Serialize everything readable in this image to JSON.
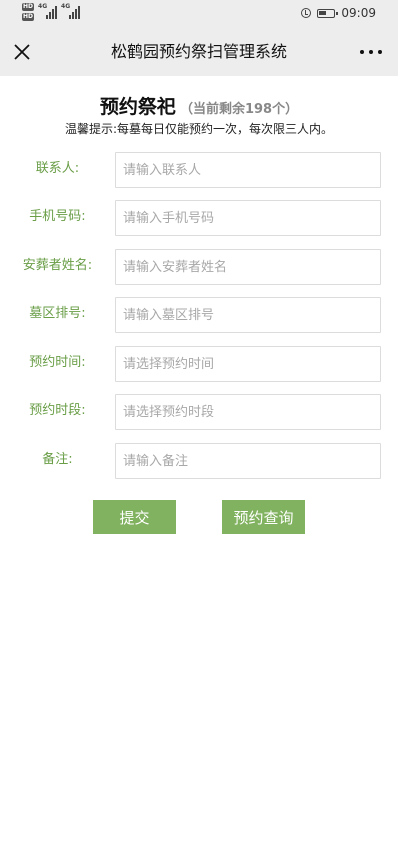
{
  "status_bar": {
    "time": "09:09",
    "left_badges": [
      "HD",
      "HD"
    ],
    "network": [
      "4G",
      "4G"
    ]
  },
  "nav": {
    "title": "松鹤园预约祭扫管理系统",
    "close_icon": "close-icon",
    "more_icon": "more-icon"
  },
  "heading": {
    "main": "预约祭祀",
    "remaining": "（当前剩余198个）"
  },
  "notice": "温馨提示:每墓每日仅能预约一次，每次限三人内。",
  "form": {
    "contact": {
      "label": "联系人:",
      "placeholder": "请输入联系人",
      "value": ""
    },
    "phone": {
      "label": "手机号码:",
      "placeholder": "请输入手机号码",
      "value": ""
    },
    "deceased_name": {
      "label": "安葬者姓名:",
      "placeholder": "请输入安葬者姓名",
      "value": ""
    },
    "plot_number": {
      "label": "墓区排号:",
      "placeholder": "请输入墓区排号",
      "value": ""
    },
    "date": {
      "label": "预约时间:",
      "placeholder": "请选择预约时间",
      "value": ""
    },
    "time_slot": {
      "label": "预约时段:",
      "placeholder": "请选择预约时段",
      "value": ""
    },
    "remark": {
      "label": "备注:",
      "placeholder": "请输入备注",
      "value": ""
    }
  },
  "buttons": {
    "submit": "提交",
    "query": "预约查询"
  },
  "colors": {
    "accent_green": "#80b25f",
    "label_green": "#6a9e47",
    "bar_gray": "#ededed"
  }
}
